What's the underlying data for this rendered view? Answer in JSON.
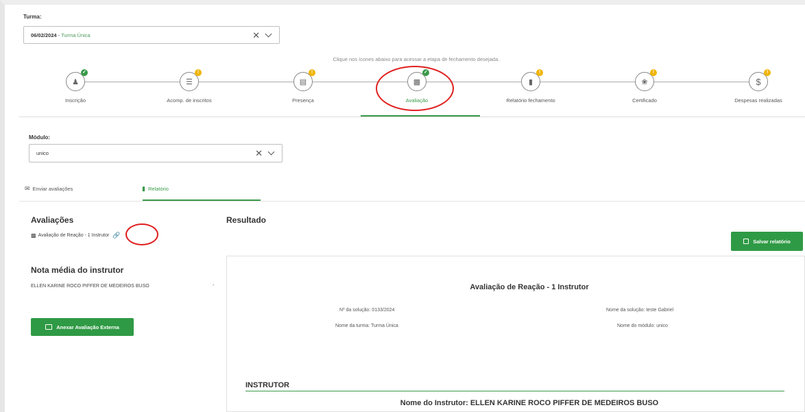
{
  "turma": {
    "label": "Turma:",
    "value_date": "06/02/2024",
    "value_sep": " - ",
    "value_name": "Turma Única"
  },
  "hint": "Clique nos ícones abaixo para acessar a etapa de fechamento desejada.",
  "steps": [
    {
      "label": "Inscrição",
      "icon": "users-icon",
      "status": "ok"
    },
    {
      "label": "Acomp. de inscritos",
      "icon": "list-icon",
      "status": "warn"
    },
    {
      "label": "Presença",
      "icon": "document-icon",
      "status": "warn"
    },
    {
      "label": "Avaliação",
      "icon": "chart-icon",
      "status": "ok",
      "active": true
    },
    {
      "label": "Relatório fechamento",
      "icon": "file-icon",
      "status": "warn"
    },
    {
      "label": "Certificado",
      "icon": "certificate-icon",
      "status": "warn"
    },
    {
      "label": "Despesas realizadas",
      "icon": "dollar-icon",
      "status": "warn"
    }
  ],
  "modulo": {
    "label": "Módulo:",
    "value": "unico"
  },
  "tabs": [
    {
      "label": "Enviar avaliações"
    },
    {
      "label": "Relatório",
      "active": true
    }
  ],
  "avaliacoes": {
    "title": "Avaliações",
    "item": "Avaliação de Reação - 1  Instrutor"
  },
  "nota": {
    "title": "Nota média do instrutor",
    "instructor": "ELLEN KARINE ROCO PIFFER DE MEDEIROS BUSO",
    "value": "-"
  },
  "anexar_button": "Anexar Avaliação Externa",
  "resultado": {
    "title": "Resultado",
    "save_button": "Salvar relatório",
    "report_title": "Avaliação de Reação - 1  Instrutor",
    "numero_solucao": "Nº da solução: 0133/2024",
    "nome_solucao": "Nome da solução: teste Gabriel",
    "nome_turma": "Nome da turma: Turma Única",
    "nome_modulo": "Nome do módulo: unico",
    "section": "INSTRUTOR",
    "instrutor_name": "Nome do Instrutor: ELLEN KARINE ROCO PIFFER DE MEDEIROS BUSO"
  },
  "colors": {
    "accent": "#2f9a45",
    "warning": "#f0b400",
    "annotation": "#e02020"
  }
}
